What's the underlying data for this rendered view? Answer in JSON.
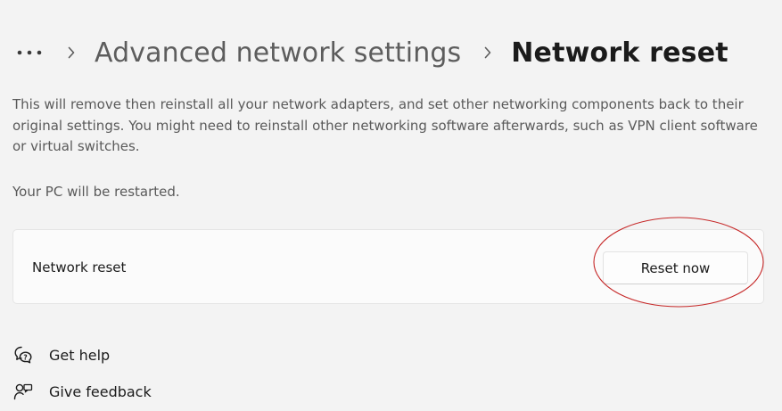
{
  "breadcrumb": {
    "more_icon": "more-horizontal-icon",
    "separator_icon": "chevron-right-icon",
    "parent": "Advanced network settings",
    "current": "Network reset"
  },
  "description": "This will remove then reinstall all your network adapters, and set other networking components back to their original settings. You might need to reinstall other networking software afterwards, such as VPN client software or virtual switches.",
  "restart_notice": "Your PC will be restarted.",
  "card": {
    "label": "Network reset",
    "button_label": "Reset now"
  },
  "help_links": [
    {
      "label": "Get help",
      "icon": "get-help-icon"
    },
    {
      "label": "Give feedback",
      "icon": "give-feedback-icon"
    }
  ],
  "colors": {
    "background": "#f3f3f3",
    "card": "#fbfbfb",
    "annotation": "#c62828"
  }
}
